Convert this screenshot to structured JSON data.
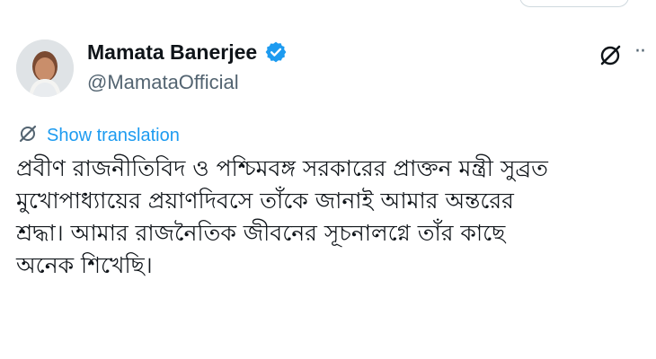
{
  "author": {
    "name": "Mamata Banerjee",
    "handle": "@MamataOfficial",
    "verified": true,
    "avatar_icon": "profile-photo"
  },
  "actions": {
    "grok_icon": "grok-icon",
    "more_label": "··"
  },
  "translation": {
    "label": "Show translation",
    "icon": "grok-icon"
  },
  "tweet": {
    "text": "প্রবীণ রাজনীতিবিদ ও পশ্চিমবঙ্গ সরকারের প্রাক্তন মন্ত্রী সুব্রত\nমুখোপাধ্যায়ের প্রয়াণদিবসে তাঁকে জানাই আমার অন্তরের\nশ্রদ্ধা। আমার রাজনৈতিক জীবনের সূচনালগ্নে তাঁর কাছে\nঅনেক শিখেছি।"
  },
  "colors": {
    "text": "#0f1419",
    "secondary": "#536471",
    "accent": "#1d9bf0",
    "background": "#ffffff"
  }
}
